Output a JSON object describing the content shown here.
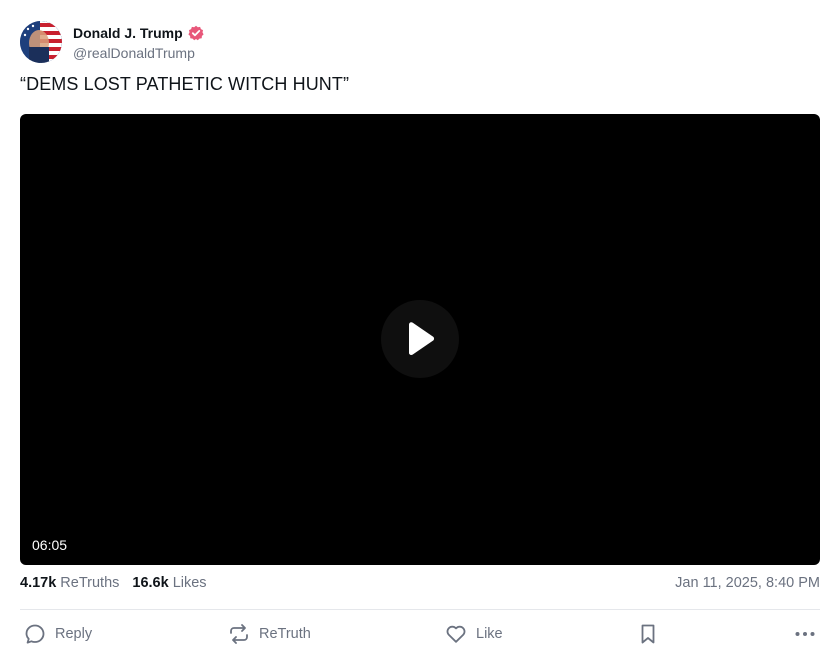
{
  "post": {
    "author": {
      "display_name": "Donald J. Trump",
      "handle": "@realDonaldTrump",
      "verified": true,
      "verified_color": "#e8577a"
    },
    "text": "“DEMS LOST PATHETIC WITCH HUNT”",
    "video": {
      "duration": "06:05",
      "play_icon": "play-icon"
    },
    "stats": {
      "retruths_count": "4.17k",
      "retruths_label": "ReTruths",
      "likes_count": "16.6k",
      "likes_label": "Likes",
      "timestamp": "Jan 11, 2025, 8:40 PM"
    },
    "actions": {
      "reply_label": "Reply",
      "retruth_label": "ReTruth",
      "like_label": "Like"
    }
  },
  "colors": {
    "text_primary": "#0f1419",
    "text_secondary": "#6b7280",
    "divider": "#e5e7eb",
    "video_bg": "#000000"
  }
}
